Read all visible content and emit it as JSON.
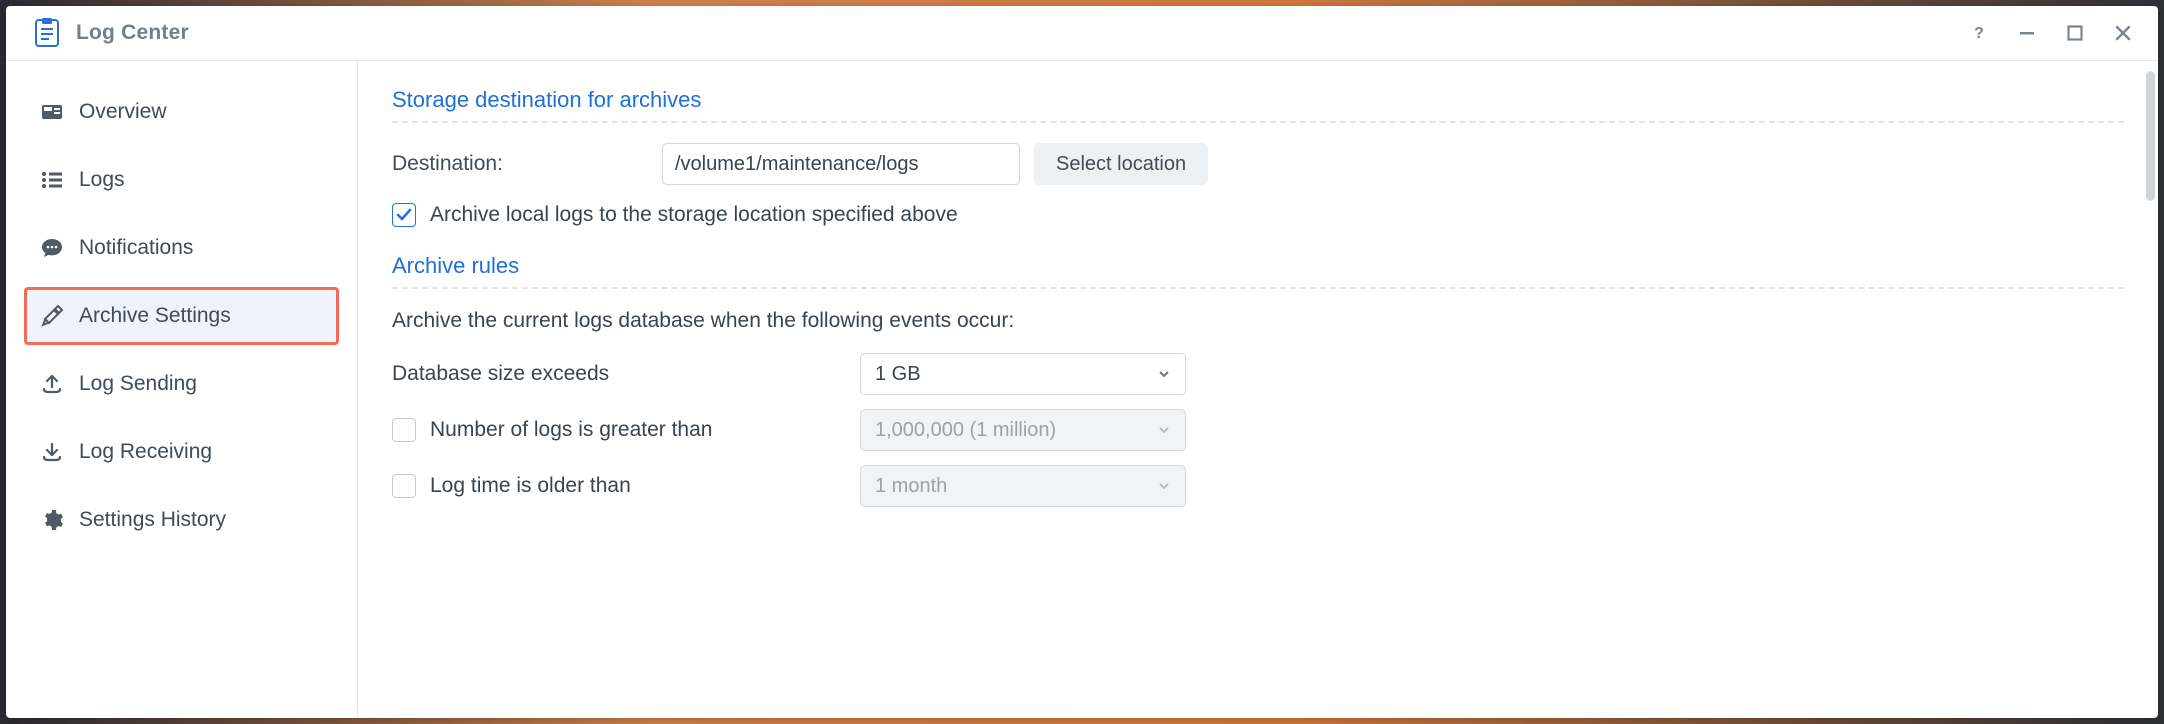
{
  "app": {
    "title": "Log Center"
  },
  "sidebar": {
    "items": [
      {
        "label": "Overview"
      },
      {
        "label": "Logs"
      },
      {
        "label": "Notifications"
      },
      {
        "label": "Archive Settings"
      },
      {
        "label": "Log Sending"
      },
      {
        "label": "Log Receiving"
      },
      {
        "label": "Settings History"
      }
    ],
    "active_index": 3
  },
  "sections": {
    "storage": {
      "title": "Storage destination for archives",
      "dest_label": "Destination:",
      "dest_value": "/volume1/maintenance/logs",
      "select_btn": "Select location",
      "archive_local_checked": true,
      "archive_local_label": "Archive local logs to the storage location specified above"
    },
    "rules": {
      "title": "Archive rules",
      "intro": "Archive the current logs database when the following events occur:",
      "db_size_label": "Database size exceeds",
      "db_size_value": "1 GB",
      "num_logs_checked": false,
      "num_logs_label": "Number of logs is greater than",
      "num_logs_value": "1,000,000 (1 million)",
      "log_time_checked": false,
      "log_time_label": "Log time is older than",
      "log_time_value": "1 month"
    }
  }
}
